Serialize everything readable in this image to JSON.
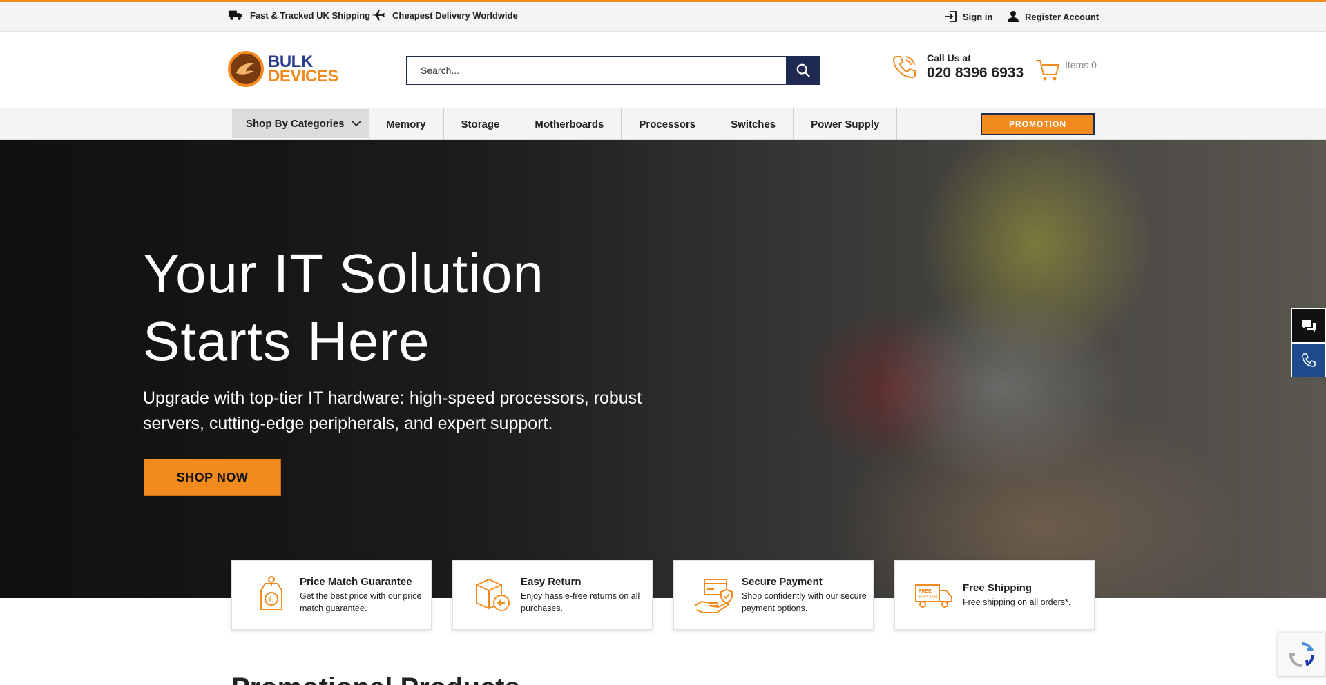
{
  "topbar": {
    "shipping_text": "Fast & Tracked UK Shipping",
    "delivery_text": "Cheapest Delivery Worldwide",
    "signin_label": "Sign in",
    "register_label": "Register Account"
  },
  "header": {
    "logo_line1": "BULK",
    "logo_line2": "DEVICES",
    "search_placeholder": "Search...",
    "call_label": "Call Us at",
    "call_number": "020 8396 6933",
    "cart_items_label": "Items",
    "cart_count": "0"
  },
  "nav": {
    "categories_label": "Shop By Categories",
    "items": [
      {
        "label": "Memory"
      },
      {
        "label": "Storage"
      },
      {
        "label": "Motherboards"
      },
      {
        "label": "Processors"
      },
      {
        "label": "Switches"
      },
      {
        "label": "Power Supply"
      }
    ],
    "promotion_label": "PROMOTION"
  },
  "hero": {
    "title": "Your IT Solution Starts Here",
    "subtitle": "Upgrade with top-tier IT hardware: high-speed processors, robust servers, cutting-edge peripherals, and expert support.",
    "cta_label": "SHOP NOW"
  },
  "features": [
    {
      "title": "Price Match Guarantee",
      "desc": "Get the best price with our price match guarantee.",
      "icon": "price-tag-icon"
    },
    {
      "title": "Easy Return",
      "desc": "Enjoy hassle-free returns on all purchases.",
      "icon": "return-box-icon"
    },
    {
      "title": "Secure Payment",
      "desc": "Shop confidently with our secure payment options.",
      "icon": "secure-payment-icon"
    },
    {
      "title": "Free Shipping",
      "desc": "Free shipping on all orders*.",
      "icon": "free-shipping-truck-icon"
    }
  ],
  "section": {
    "heading": "Promotional Products"
  },
  "colors": {
    "accent": "#f28a1e",
    "brand_navy": "#1e2a52",
    "side_phone_blue": "#1e4a8c"
  }
}
